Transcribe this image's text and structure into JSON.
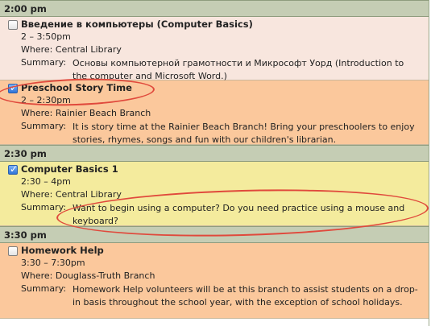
{
  "labels": {
    "where": "Where:",
    "summary": "Summary:"
  },
  "slots": [
    {
      "time": "2:00 pm",
      "events": [
        {
          "title": "Введение в компьютеры (Computer Basics)",
          "checked": false,
          "time": "2 – 3:50pm",
          "where": "Central Library",
          "summary": "Основы компьютерной грамотности и Микрософт Уорд (Introduction to the computer and Microsoft Word.)"
        },
        {
          "title": "Preschool Story Time",
          "checked": true,
          "time": "2 – 2:30pm",
          "where": "Rainier Beach Branch",
          "summary": "It is story time at the Rainier Beach Branch! Bring your preschoolers to enjoy stories, rhymes, songs and fun with our children's librarian."
        }
      ]
    },
    {
      "time": "2:30 pm",
      "events": [
        {
          "title": "Computer Basics 1",
          "checked": true,
          "time": "2:30 – 4pm",
          "where": "Central Library",
          "summary": "Want to begin using a computer? Do you need practice using a mouse and keyboard?"
        }
      ]
    },
    {
      "time": "3:30 pm",
      "events": [
        {
          "title": "Homework Help",
          "checked": false,
          "time": "3:30 – 7:30pm",
          "where": "Douglass-Truth Branch",
          "summary": "Homework Help volunteers will be at this branch to assist students on a drop-in basis throughout the school year, with the exception of school holidays."
        }
      ]
    }
  ],
  "colors": {
    "highlight_oval": "#e0493c"
  }
}
